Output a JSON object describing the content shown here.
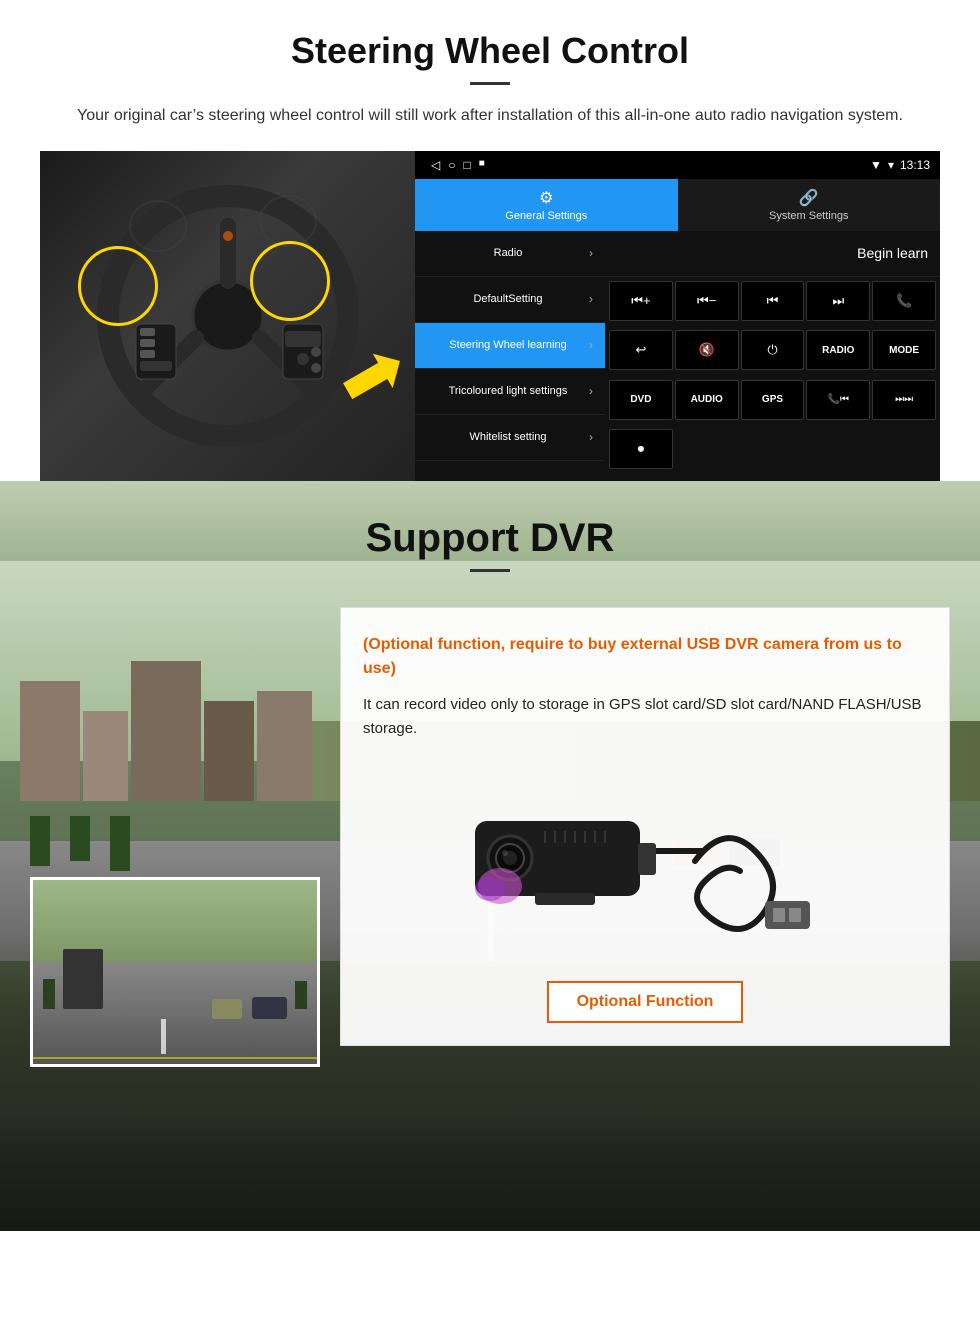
{
  "steering": {
    "title": "Steering Wheel Control",
    "subtitle": "Your original car’s steering wheel control will still work after installation of this all-in-one auto radio navigation system.",
    "status_bar": {
      "time": "13:13",
      "icons": [
        "back-icon",
        "home-icon",
        "square-icon",
        "rec-icon"
      ]
    },
    "tabs": [
      {
        "label": "General Settings",
        "icon": "⚙",
        "active": true
      },
      {
        "label": "System Settings",
        "icon": "🔗",
        "active": false
      }
    ],
    "menu_items": [
      {
        "label": "Radio",
        "active": false
      },
      {
        "label": "DefaultSetting",
        "active": false
      },
      {
        "label": "Steering Wheel learning",
        "active": true
      },
      {
        "label": "Tricoloured light settings",
        "active": false
      },
      {
        "label": "Whitelist setting",
        "active": false
      }
    ],
    "begin_learn": "Begin learn",
    "controls": [
      {
        "icon": "⏮+",
        "type": "icon"
      },
      {
        "icon": "⏮−",
        "type": "icon"
      },
      {
        "icon": "⏮",
        "type": "icon"
      },
      {
        "icon": "⏭",
        "type": "icon"
      },
      {
        "icon": "📞",
        "type": "icon"
      },
      {
        "icon": "↩",
        "type": "icon"
      },
      {
        "icon": "🔇×",
        "type": "icon"
      },
      {
        "icon": "⏻",
        "type": "icon"
      },
      {
        "label": "RADIO",
        "type": "text"
      },
      {
        "label": "MODE",
        "type": "text"
      },
      {
        "label": "DVD",
        "type": "text"
      },
      {
        "label": "AUDIO",
        "type": "text"
      },
      {
        "label": "GPS",
        "type": "text"
      },
      {
        "icon": "📞⏮",
        "type": "icon"
      },
      {
        "icon": "⏭⏭",
        "type": "icon"
      },
      {
        "icon": "⏺",
        "type": "icon"
      }
    ]
  },
  "dvr": {
    "title": "Support DVR",
    "optional_text": "(Optional function, require to buy external USB DVR camera from us to use)",
    "description": "It can record video only to storage in GPS slot card/SD slot card/NAND FLASH/USB storage.",
    "optional_button_label": "Optional Function"
  }
}
